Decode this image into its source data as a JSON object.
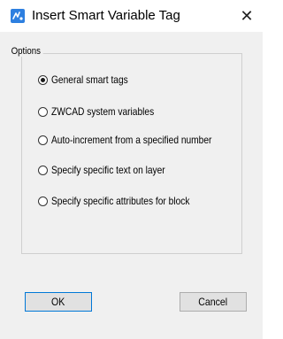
{
  "window": {
    "title": "Insert Smart Variable Tag",
    "close_glyph": "✕",
    "icon": "zwcad-variable-icon"
  },
  "options": {
    "label": "Options",
    "selected_index": 0,
    "items": [
      {
        "label": "General smart tags",
        "checked": true
      },
      {
        "label": "ZWCAD system variables",
        "checked": false
      },
      {
        "label": "Auto-increment from a specified number",
        "checked": false
      },
      {
        "label": "Specify specific text on layer",
        "checked": false
      },
      {
        "label": "Specify specific attributes for block",
        "checked": false
      }
    ]
  },
  "buttons": {
    "ok_label": "OK",
    "cancel_label": "Cancel"
  },
  "colors": {
    "accent": "#0078d7",
    "dialog_bg": "#f0f0f0"
  }
}
